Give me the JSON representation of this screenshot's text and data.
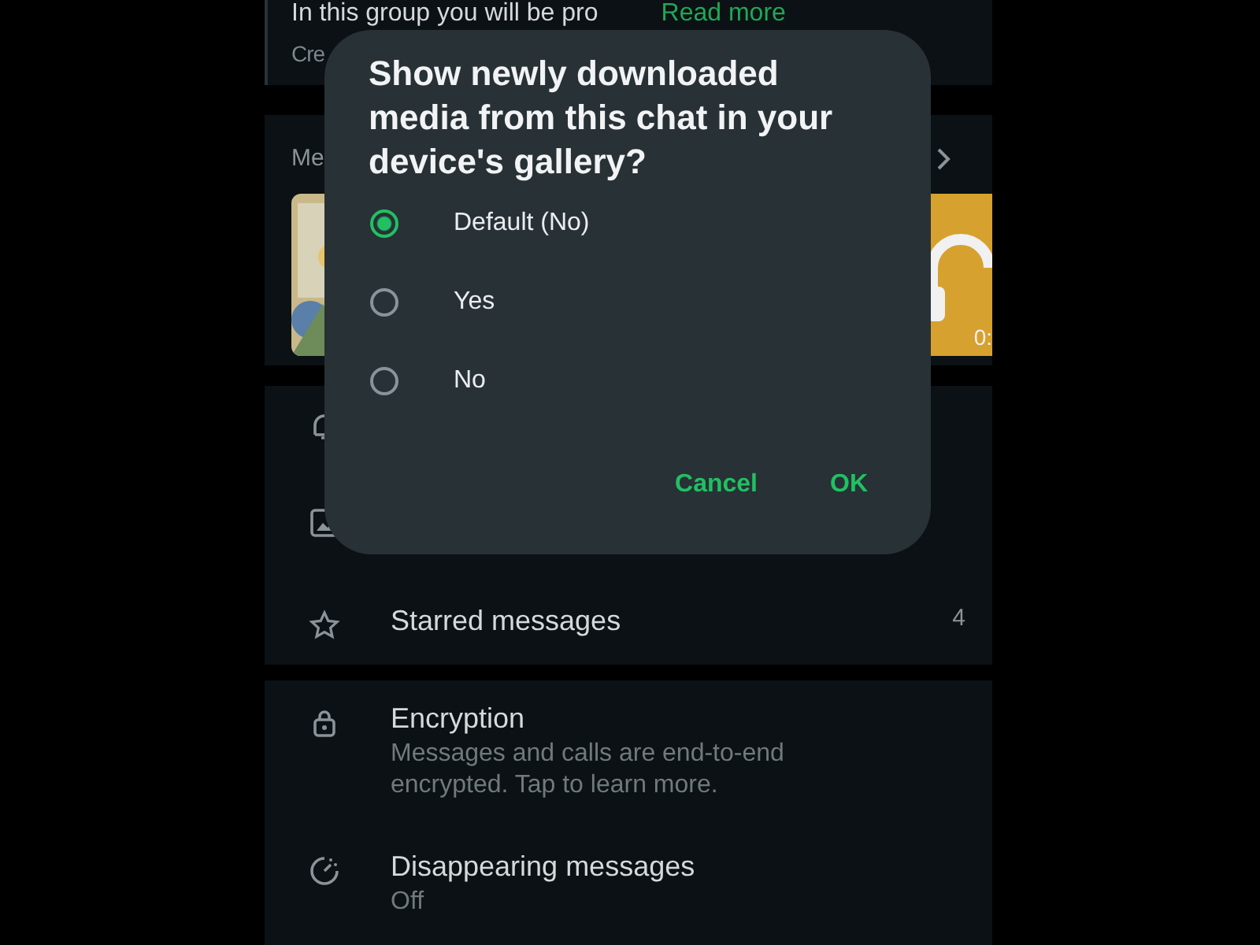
{
  "background": {
    "description": {
      "text": "In this group you will be pro",
      "link": "Read more"
    },
    "created": "Cre",
    "media": {
      "label": "Me",
      "thumbnails": [
        {
          "kind": "picture"
        },
        {
          "kind": "audio",
          "duration": "0:"
        }
      ]
    },
    "settings": [
      {
        "kind": "notifications"
      },
      {
        "kind": "media_visibility"
      },
      {
        "kind": "starred",
        "label": "Starred messages",
        "count": "4"
      }
    ],
    "privacy": [
      {
        "kind": "encryption",
        "label": "Encryption",
        "detail": "Messages and calls are end-to-end encrypted. Tap to learn more."
      },
      {
        "kind": "disappearing",
        "label": "Disappearing messages",
        "detail": "Off"
      }
    ]
  },
  "dialog": {
    "title": "Show newly downloaded media from this chat in your device's gallery?",
    "options": [
      {
        "label": "Default (No)",
        "selected": true
      },
      {
        "label": "Yes",
        "selected": false
      },
      {
        "label": "No",
        "selected": false
      }
    ],
    "buttons": [
      "Cancel",
      "OK"
    ]
  }
}
